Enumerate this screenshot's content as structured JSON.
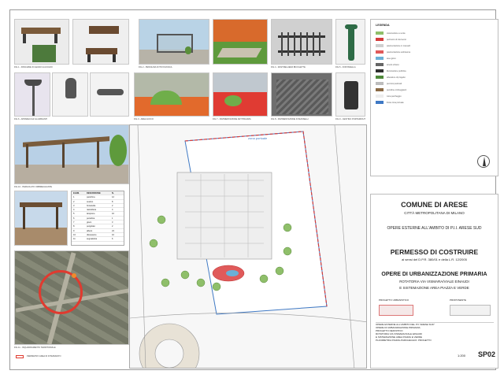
{
  "legend": {
    "title": "LEGENDA",
    "items": [
      {
        "label": "sistemazione a verde",
        "color": "#8fbf6a"
      },
      {
        "label": "perimetro di intervento",
        "color": "#d43c3c"
      },
      {
        "label": "pavimentazione in masselli",
        "color": "#cfcfcf"
      },
      {
        "label": "pavimentazione antitrauma",
        "color": "#e05a5a"
      },
      {
        "label": "aree gioco",
        "color": "#6ab0d6"
      },
      {
        "label": "arredo urbano",
        "color": "#666666"
      },
      {
        "label": "illuminazione pubblica",
        "color": "#2f2f2f"
      },
      {
        "label": "alberature di progetto",
        "color": "#4f8a3a"
      },
      {
        "label": "percorsi pedonali",
        "color": "#bdbdbd"
      },
      {
        "label": "pensiline ombreggianti",
        "color": "#8a6a45"
      },
      {
        "label": "zona parcheggio",
        "color": "#ededed"
      },
      {
        "label": "limite zona portuale",
        "color": "#3f79c4"
      }
    ]
  },
  "title_block": {
    "municipality": "COMUNE DI ARESE",
    "metro_city": "CITTÀ METROPOLITANA DI MILANO",
    "project": "OPERE ESTERNE ALL'AMBITO DI P.I.I. ARESE SUD",
    "permit": "PERMESSO DI COSTRUIRE",
    "law_ref": "ai sensi del D.P.R. 380/01 e della L.R. 12/2005",
    "works_title": "OPERE DI URBANIZZAZIONE PRIMARIA",
    "works_line1": "ROTATORIA VIA VISMARA/VIALE EINAUDI",
    "works_line2": "E SISTEMAZIONE AREA PIAZZA E VERDE",
    "designer_label": "PROGETTO URBANISTICO",
    "proponent_label": "PROPONENTE",
    "scale": "1:200",
    "sheet_code": "SP02",
    "subtitle1": "OPERE ESTERNE ALL'AMBITO DEL PII \"ARESE SUD\"",
    "subtitle2": "OPERE DI URBANIZZAZIONE PRIMARIA",
    "subtitle3": "PROGETTO DEFINITIVO",
    "subtitle4": "ROTATORIA VIA VISMARA/VIALE EINAUDI",
    "subtitle5": "E SISTEMAZIONE AREA PIAZZA E VERDE",
    "subtitle6": "PLANIMETRIA PIAZZA-PARCHEGGIO: PROGETTO"
  },
  "plan": {
    "zone_label": "zona portuale"
  },
  "photo_captions": [
    "FIG.1 - PANCHINE IN LEGNO E ACCIAIO",
    "FIG.2 - PENSILINA FOTOVOLTAICA",
    "FIG.3 - AREA GIOCO",
    "FIG.4 - RASTRELLIERA BICICLETTE",
    "FIG.5 - FONTANELLA",
    "FIG.6 - APPARECCHI ILLUMINANTI",
    "FIG.7 - PAVIMENTAZIONE ANTITRAUMA",
    "FIG.8 - PAVIMENTAZIONE IN MASSELLI",
    "FIG.9 - CESTINO PORTARIFIUTI",
    "FIG.10 - PERGOLATO OMBREGGIANTE",
    "FIG.11 - INQUADRAMENTO TERRITORIALE"
  ],
  "map_caption": "PERIMETRO AREA DI INTERVENTO",
  "table": {
    "headers": [
      "ELEM.",
      "DESCRIZIONE",
      "N."
    ],
    "rows": [
      [
        "1",
        "panchina",
        "12"
      ],
      [
        "2",
        "cestino",
        "8"
      ],
      [
        "3",
        "fontanella",
        "2"
      ],
      [
        "4",
        "rastrelliera",
        "4"
      ],
      [
        "5",
        "lampione",
        "16"
      ],
      [
        "6",
        "pensilina",
        "1"
      ],
      [
        "7",
        "gioco",
        "3"
      ],
      [
        "8",
        "pergolato",
        "2"
      ],
      [
        "9",
        "albero",
        "24"
      ],
      [
        "10",
        "dissuasore",
        "10"
      ],
      [
        "11",
        "segnaletica",
        "6"
      ]
    ]
  },
  "colors": {
    "grass": "#6fae4a",
    "rubber_red": "#e03b33",
    "boundary_red": "#d43c3c",
    "boundary_blue": "#3f79c4",
    "paving": "#d9d9d9"
  }
}
